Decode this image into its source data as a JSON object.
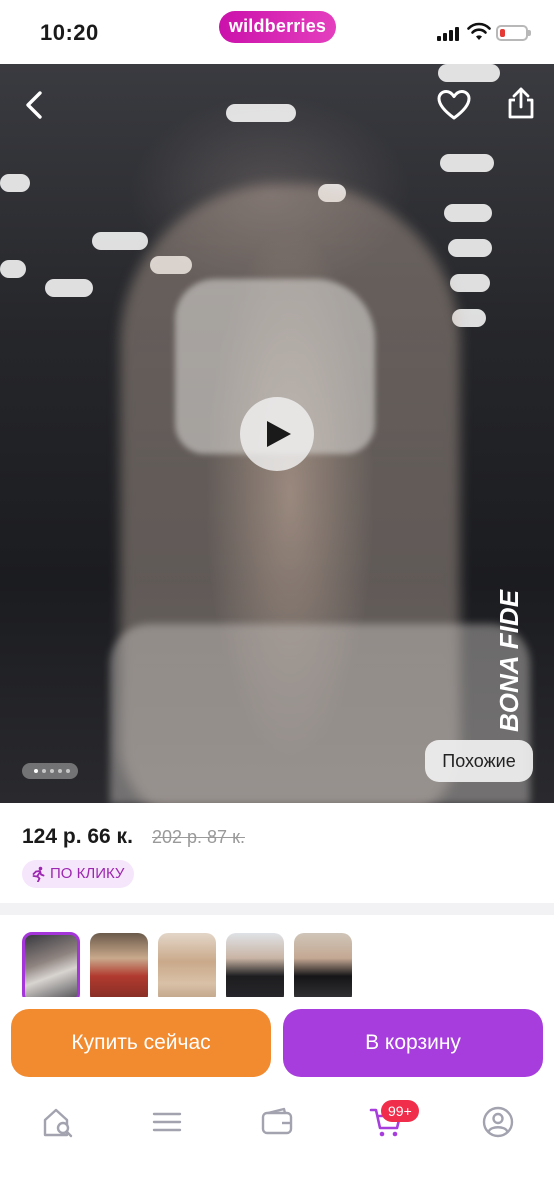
{
  "status_bar": {
    "time": "10:20",
    "brand": "wildberries",
    "battery_level": "low",
    "icons": [
      "cellular-signal-icon",
      "wifi-icon",
      "battery-icon"
    ]
  },
  "hero": {
    "icons": [
      "back-arrow-icon",
      "heart-icon",
      "share-icon",
      "play-icon"
    ],
    "watermark_text": "BONA FIDE",
    "carousel_dots": 5,
    "carousel_active": 1,
    "similar_label": "Похожие"
  },
  "product": {
    "price": "124 р. 66 к.",
    "old_price": "202 р. 87 к.",
    "promo_label": "ПО КЛИКУ",
    "promo_icon": "running-person-icon"
  },
  "thumbnails": {
    "count": 5,
    "active_index": 0
  },
  "actions": {
    "buy_now": "Купить сейчас",
    "add_to_cart": "В корзину"
  },
  "tab_bar": {
    "tabs": [
      "home-search-icon",
      "menu-icon",
      "wallet-icon",
      "cart-icon",
      "profile-icon"
    ],
    "cart_badge": "99+",
    "active_tab": "cart-icon"
  },
  "colors": {
    "brand_purple": "#a73ddc",
    "buy_orange": "#f28b30",
    "badge_red": "#f02e4b"
  }
}
